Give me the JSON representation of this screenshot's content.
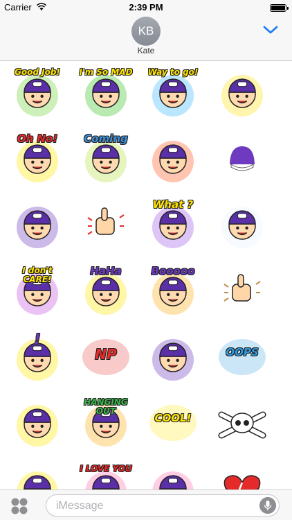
{
  "status_bar": {
    "carrier": "Carrier",
    "time": "2:39 PM"
  },
  "header": {
    "avatar_initials": "KB",
    "contact_name": "Kate",
    "collapse_icon": "chevron-down-icon"
  },
  "stickers": [
    {
      "name": "good-job-sticker",
      "caption": "Good Job!",
      "kind": "char-text",
      "colors": [
        "#6fd23a",
        "#ffe400"
      ]
    },
    {
      "name": "im-so-mad-sticker",
      "caption": "I'm So MAD",
      "kind": "char-text",
      "colors": [
        "#34c221",
        "#ffe400"
      ]
    },
    {
      "name": "way-to-go-sticker",
      "caption": "Way to go!",
      "kind": "char-text",
      "colors": [
        "#38b6ff",
        "#ffe400"
      ]
    },
    {
      "name": "bananas-sticker",
      "caption": "",
      "kind": "char",
      "colors": [
        "#ffe11a",
        "#7a3cc4"
      ]
    },
    {
      "name": "oh-no-sticker",
      "caption": "Oh No!",
      "kind": "char-text",
      "colors": [
        "#ffe400",
        "#e52a2a"
      ]
    },
    {
      "name": "coming-sticker",
      "caption": "Coming",
      "kind": "char-text",
      "colors": [
        "#b7e043",
        "#3d8fd8"
      ]
    },
    {
      "name": "angry-fire-sticker",
      "caption": "",
      "kind": "char",
      "colors": [
        "#ff5a1f",
        "#ffd21a"
      ]
    },
    {
      "name": "cap-sticker",
      "caption": "",
      "kind": "cap",
      "colors": [
        "#6d3ac0",
        "#ffffff"
      ]
    },
    {
      "name": "confused-sticker",
      "caption": "",
      "kind": "char",
      "colors": [
        "#6d3ac0",
        "#ffffff"
      ]
    },
    {
      "name": "thumbs-up-sticker",
      "caption": "",
      "kind": "hand",
      "colors": [
        "#ffd6a8",
        "#e52a2a"
      ]
    },
    {
      "name": "what-sticker",
      "caption": "What ?",
      "kind": "char-text",
      "colors": [
        "#a15ae8",
        "#ffe400"
      ]
    },
    {
      "name": "toilet-sticker",
      "caption": "",
      "kind": "char",
      "colors": [
        "#e8f2ff",
        "#ffe400"
      ]
    },
    {
      "name": "i-dont-care-sticker",
      "caption": "I don't CARE!",
      "kind": "char-text",
      "colors": [
        "#c64fe0",
        "#ffe400"
      ]
    },
    {
      "name": "hahaha-sticker",
      "caption": "HaHa",
      "kind": "char-text",
      "colors": [
        "#ffe400",
        "#6d3ac0"
      ]
    },
    {
      "name": "boo-sticker",
      "caption": "Booooo",
      "kind": "char-text",
      "colors": [
        "#ffb01a",
        "#6d3ac0"
      ]
    },
    {
      "name": "rock-hand-sticker",
      "caption": "",
      "kind": "hand",
      "colors": [
        "#ffd6a8",
        "#c28a4a"
      ]
    },
    {
      "name": "crying-sticker",
      "caption": "!",
      "kind": "char-text",
      "colors": [
        "#ffe400",
        "#6d3ac0"
      ]
    },
    {
      "name": "np-sticker",
      "caption": "NP",
      "kind": "text",
      "colors": [
        "#ffb01a",
        "#e52a2a"
      ]
    },
    {
      "name": "singing-sticker",
      "caption": "",
      "kind": "char",
      "colors": [
        "#6d3ac0",
        "#ffe400"
      ]
    },
    {
      "name": "oops-sticker",
      "caption": "OOPS",
      "kind": "text",
      "colors": [
        "#a15ae8",
        "#2f9be0"
      ]
    },
    {
      "name": "surprised-sticker",
      "caption": "",
      "kind": "char",
      "colors": [
        "#ffe400",
        "#6d3ac0"
      ]
    },
    {
      "name": "hanging-out-sticker",
      "caption": "HANGING OUT",
      "kind": "char-text",
      "colors": [
        "#ffb01a",
        "#3bb54a"
      ]
    },
    {
      "name": "cool-sticker",
      "caption": "COOL!",
      "kind": "text",
      "colors": [
        "#9be22a",
        "#ffe400"
      ]
    },
    {
      "name": "skull-sticker",
      "caption": "",
      "kind": "skull",
      "colors": [
        "#ffffff",
        "#222222"
      ]
    },
    {
      "name": "happy-sticker",
      "caption": "",
      "kind": "char",
      "colors": [
        "#ffe400",
        "#6d3ac0"
      ]
    },
    {
      "name": "i-love-you-sticker",
      "caption": "I LOVE YOU",
      "kind": "char-text",
      "colors": [
        "#ff6fb1",
        "#e52a2a"
      ]
    },
    {
      "name": "heart-eyes-sticker",
      "caption": "",
      "kind": "char",
      "colors": [
        "#ff6fb1",
        "#6d3ac0"
      ]
    },
    {
      "name": "broken-heart-sticker",
      "caption": "",
      "kind": "heart",
      "colors": [
        "#e52a2a",
        "#ffffff"
      ]
    }
  ],
  "input_bar": {
    "apps_icon": "apps-grid-icon",
    "placeholder": "iMessage",
    "mic_icon": "microphone-icon"
  }
}
